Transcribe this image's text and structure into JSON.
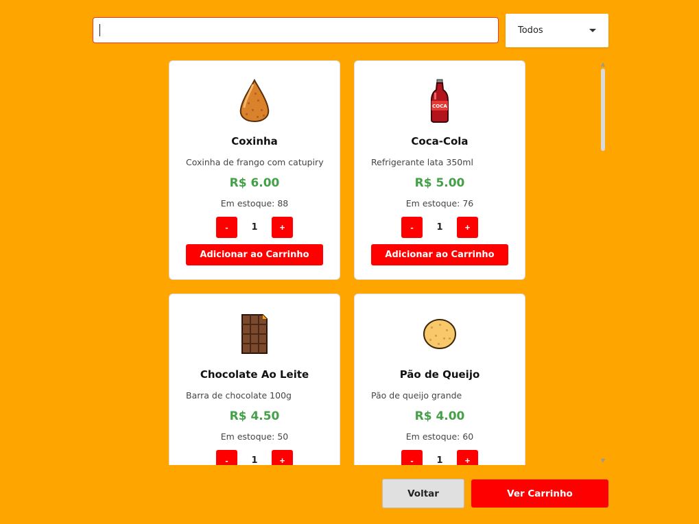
{
  "search": {
    "placeholder": "",
    "value": ""
  },
  "filter": {
    "selected": "Todos"
  },
  "products": [
    {
      "name": "Coxinha",
      "description": "Coxinha de frango com catupiry",
      "price": "R$ 6.00",
      "stock": "Em estoque: 88",
      "qty": "1",
      "icon": "coxinha-icon"
    },
    {
      "name": "Coca-Cola",
      "description": "Refrigerante lata 350ml",
      "price": "R$ 5.00",
      "stock": "Em estoque: 76",
      "qty": "1",
      "icon": "coca-cola-bottle-icon"
    },
    {
      "name": "Chocolate Ao Leite",
      "description": "Barra de chocolate 100g",
      "price": "R$ 4.50",
      "stock": "Em estoque: 50",
      "qty": "1",
      "icon": "chocolate-bar-icon"
    },
    {
      "name": "Pão de Queijo",
      "description": "Pão de queijo grande",
      "price": "R$ 4.00",
      "stock": "Em estoque: 60",
      "qty": "1",
      "icon": "pao-de-queijo-icon"
    }
  ],
  "labels": {
    "minus": "-",
    "plus": "+",
    "add_to_cart": "Adicionar ao Carrinho"
  },
  "footer": {
    "back": "Voltar",
    "view_cart": "Ver Carrinho"
  },
  "colors": {
    "background": "#FFA500",
    "accent": "#FF0000",
    "price": "#43A047"
  }
}
